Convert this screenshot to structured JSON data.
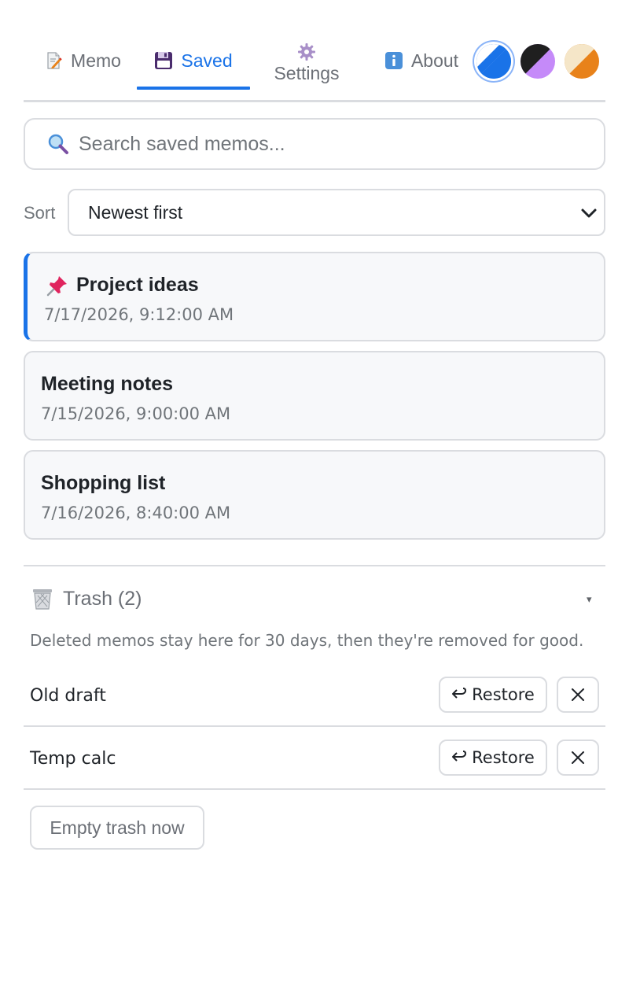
{
  "tabs": [
    {
      "label": "Memo",
      "icon": "memo-icon"
    },
    {
      "label": "Saved",
      "icon": "floppy-disk-icon",
      "active": true
    },
    {
      "label": "Settings",
      "icon": "gear-icon"
    },
    {
      "label": "About",
      "icon": "info-icon"
    }
  ],
  "themes": [
    {
      "name": "blue",
      "colors": [
        "#ffffff",
        "#1a73e8"
      ],
      "selected": true
    },
    {
      "name": "purple-dark",
      "colors": [
        "#c58af9",
        "#1f1f1f"
      ],
      "selected": false
    },
    {
      "name": "orange",
      "colors": [
        "#f5e6c8",
        "#e8821a"
      ],
      "selected": false
    }
  ],
  "accent_color": "#1a73e8",
  "search": {
    "placeholder": "Search saved memos...",
    "value": ""
  },
  "sort": {
    "label": "Sort",
    "selected": "Newest first"
  },
  "memos": [
    {
      "title": "Project ideas",
      "date": "7/17/2026, 9:12:00 AM",
      "pinned": true
    },
    {
      "title": "Meeting notes",
      "date": "7/15/2026, 9:00:00 AM",
      "pinned": false
    },
    {
      "title": "Shopping list",
      "date": "7/16/2026, 8:40:00 AM",
      "pinned": false
    }
  ],
  "trash": {
    "title": "Trash (2)",
    "toggle": "▾",
    "note": "Deleted memos stay here for 30 days, then they're removed for good.",
    "items": [
      {
        "name": "Old draft",
        "restore_label": "Restore"
      },
      {
        "name": "Temp calc",
        "restore_label": "Restore"
      }
    ],
    "empty_label": "Empty trash now"
  }
}
